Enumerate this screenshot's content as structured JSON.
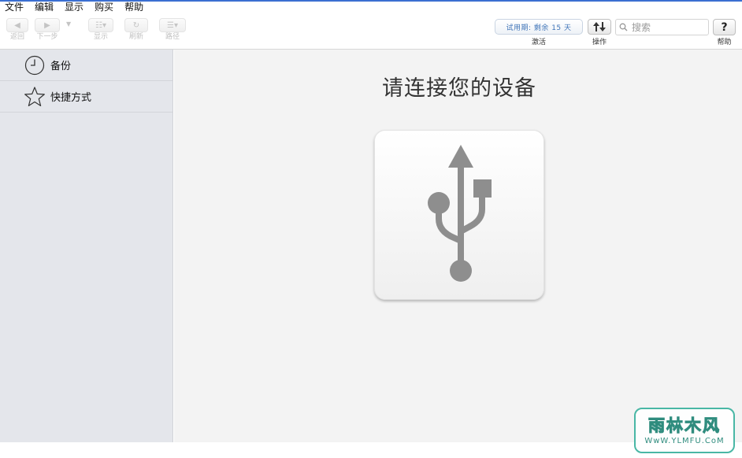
{
  "menubar": {
    "items": [
      "文件",
      "编辑",
      "显示",
      "购买",
      "帮助"
    ]
  },
  "toolbar": {
    "back_label": "返回",
    "forward_label": "下一步",
    "view_label": "显示",
    "refresh_label": "刷新",
    "path_label": "路径",
    "trial_text": "试用期: 剩余 15 天",
    "activate_label": "激活",
    "operations_label": "操作",
    "search_placeholder": "搜索",
    "help_label": "帮助"
  },
  "sidebar": {
    "items": [
      {
        "label": "备份",
        "icon": "clock-icon"
      },
      {
        "label": "快捷方式",
        "icon": "star-icon"
      }
    ]
  },
  "main": {
    "title": "请连接您的设备",
    "device_icon": "usb-icon"
  },
  "watermark": {
    "line1": "雨林木风",
    "line2": "WwW.YLMFU.CoM"
  },
  "colors": {
    "accent": "#3f74b8",
    "sidebar_bg": "#e4e6eb",
    "main_bg": "#f3f3f3",
    "usb_gray": "#8e8e8e",
    "watermark": "#49b7a5"
  }
}
